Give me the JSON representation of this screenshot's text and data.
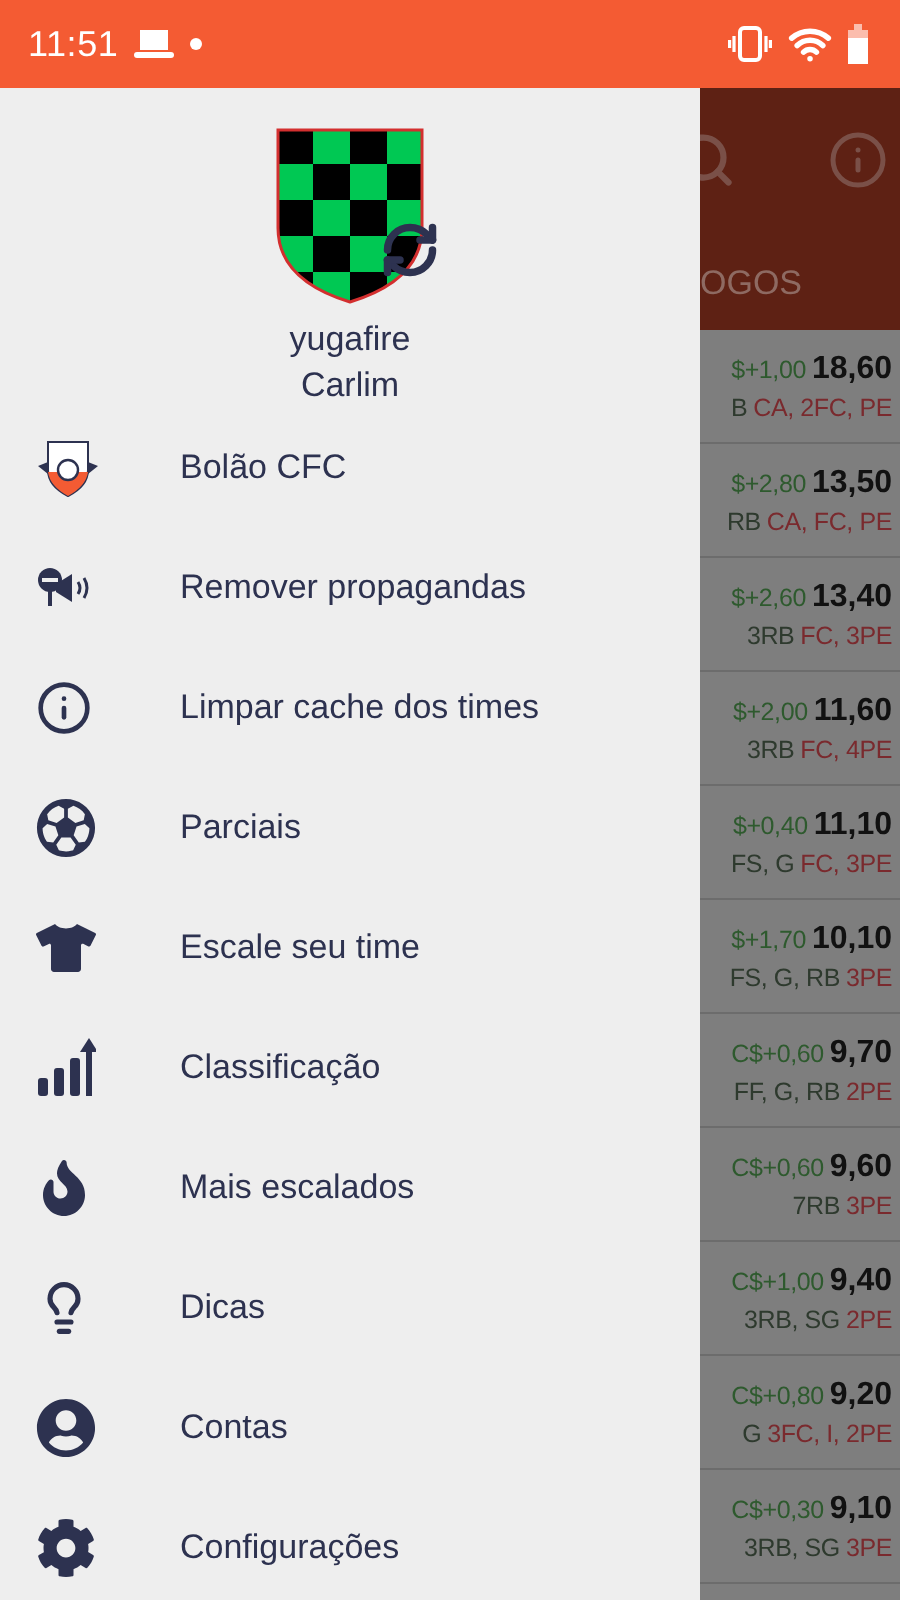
{
  "status_bar": {
    "time": "11:51"
  },
  "drawer": {
    "user": {
      "username": "yugafire",
      "team": "Carlim"
    },
    "items": [
      {
        "label": "Bolão CFC",
        "kind": "pool"
      },
      {
        "label": "Remover propagandas",
        "kind": "ads"
      },
      {
        "label": "Limpar cache dos times",
        "kind": "info"
      },
      {
        "label": "Parciais",
        "kind": "ball"
      },
      {
        "label": "Escale seu time",
        "kind": "shirt"
      },
      {
        "label": "Classificação",
        "kind": "ranking"
      },
      {
        "label": "Mais escalados",
        "kind": "fire"
      },
      {
        "label": "Dicas",
        "kind": "tip"
      },
      {
        "label": "Contas",
        "kind": "account"
      },
      {
        "label": "Configurações",
        "kind": "settings"
      }
    ]
  },
  "background": {
    "tab_label": "OGOS",
    "rows": [
      {
        "change": "$+1,00",
        "score": "18,60",
        "positives": "B",
        "negatives": "CA, 2FC, PE"
      },
      {
        "change": "$+2,80",
        "score": "13,50",
        "positives": "RB",
        "negatives": "CA, FC, PE"
      },
      {
        "change": "$+2,60",
        "score": "13,40",
        "positives": "3RB",
        "negatives": "FC, 3PE"
      },
      {
        "change": "$+2,00",
        "score": "11,60",
        "positives": "3RB",
        "negatives": "FC, 4PE"
      },
      {
        "change": "$+0,40",
        "score": "11,10",
        "positives": "FS, G",
        "negatives": "FC, 3PE"
      },
      {
        "change": "$+1,70",
        "score": "10,10",
        "positives": "FS, G, RB",
        "negatives": "3PE"
      },
      {
        "change": "C$+0,60",
        "score": "9,70",
        "positives": "FF, G, RB",
        "negatives": "2PE"
      },
      {
        "change": "C$+0,60",
        "score": "9,60",
        "positives": "7RB",
        "negatives": "3PE"
      },
      {
        "change": "C$+1,00",
        "score": "9,40",
        "positives": "3RB, SG",
        "negatives": "2PE"
      },
      {
        "change": "C$+0,80",
        "score": "9,20",
        "positives": "G",
        "negatives": "3FC, I, 2PE"
      },
      {
        "change": "C$+0,30",
        "score": "9,10",
        "positives": "3RB, SG",
        "negatives": "3PE"
      }
    ]
  }
}
